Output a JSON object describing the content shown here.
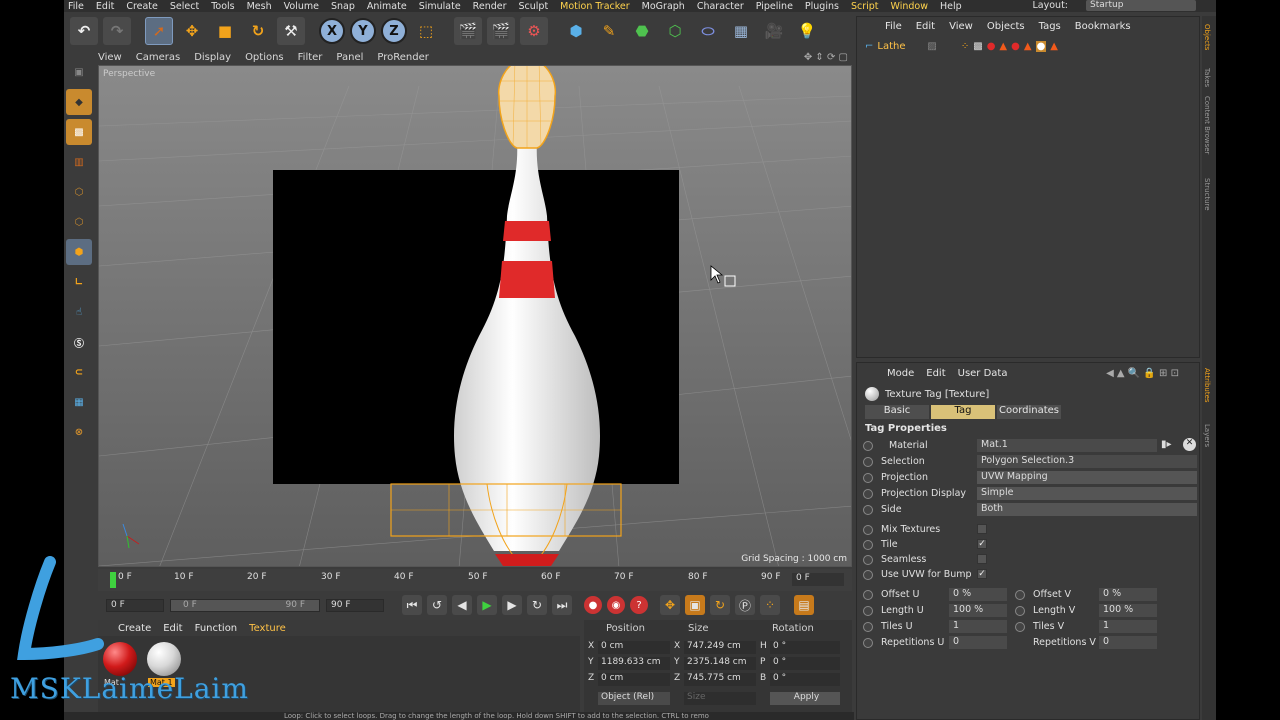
{
  "menubar": {
    "items": [
      "File",
      "Edit",
      "Create",
      "Select",
      "Tools",
      "Mesh",
      "Volume",
      "Snap",
      "Animate",
      "Simulate",
      "Render",
      "Sculpt",
      "Motion Tracker",
      "MoGraph",
      "Character",
      "Pipeline",
      "Plugins",
      "Script",
      "Window",
      "Help"
    ],
    "layout_label": "Layout:",
    "layout_value": "Startup"
  },
  "viewport": {
    "menu": [
      "View",
      "Cameras",
      "Display",
      "Options",
      "Filter",
      "Panel",
      "ProRender"
    ],
    "label": "Perspective",
    "grid_spacing": "Grid Spacing : 1000 cm"
  },
  "timeline": {
    "ticks": [
      "0 F",
      "10 F",
      "20 F",
      "30 F",
      "40 F",
      "50 F",
      "60 F",
      "70 F",
      "80 F",
      "90 F"
    ],
    "current_frame": "0 F",
    "start": "0 F",
    "range_start": "0 F",
    "range_end": "90 F",
    "end": "90 F"
  },
  "material_manager": {
    "menu": [
      "Create",
      "Edit",
      "Function",
      "Texture"
    ],
    "materials": [
      {
        "name": "Mat",
        "color": "#d11a1a"
      },
      {
        "name": "Mat.1",
        "color": "#e8e8e8"
      }
    ]
  },
  "coordinates": {
    "headers": [
      "Position",
      "Size",
      "Rotation"
    ],
    "rows": [
      {
        "axis": "X",
        "pos": "0 cm",
        "size_axis": "X",
        "size": "747.249 cm",
        "rot_axis": "H",
        "rot": "0 °"
      },
      {
        "axis": "Y",
        "pos": "1189.633 cm",
        "size_axis": "Y",
        "size": "2375.148 cm",
        "rot_axis": "P",
        "rot": "0 °"
      },
      {
        "axis": "Z",
        "pos": "0 cm",
        "size_axis": "Z",
        "size": "745.775 cm",
        "rot_axis": "B",
        "rot": "0 °"
      }
    ],
    "mode": "Object (Rel)",
    "size_mode": "Size",
    "apply": "Apply"
  },
  "status": "Loop: Click to select loops. Drag to change the length of the loop. Hold down SHIFT to add to the selection. CTRL to remo",
  "object_manager": {
    "menu": [
      "File",
      "Edit",
      "View",
      "Objects",
      "Tags",
      "Bookmarks"
    ],
    "object_name": "Lathe"
  },
  "attributes": {
    "menu": [
      "Mode",
      "Edit",
      "User Data"
    ],
    "title": "Texture Tag [Texture]",
    "tabs": [
      "Basic",
      "Tag",
      "Coordinates"
    ],
    "active_tab": "Tag",
    "section": "Tag Properties",
    "material_label": "Material",
    "material_value": "Mat.1",
    "selection_label": "Selection",
    "selection_value": "Polygon Selection.3",
    "projection_label": "Projection",
    "projection_value": "UVW Mapping",
    "projection_display_label": "Projection Display",
    "projection_display_value": "Simple",
    "side_label": "Side",
    "side_value": "Both",
    "mix_label": "Mix Textures",
    "tile_label": "Tile",
    "seamless_label": "Seamless",
    "uvw_bump_label": "Use UVW for Bump",
    "offset_u_label": "Offset U",
    "offset_u": "0 %",
    "offset_v_label": "Offset V",
    "offset_v": "0 %",
    "length_u_label": "Length U",
    "length_u": "100 %",
    "length_v_label": "Length V",
    "length_v": "100 %",
    "tiles_u_label": "Tiles U",
    "tiles_u": "1",
    "tiles_v_label": "Tiles V",
    "tiles_v": "1",
    "rep_u_label": "Repetitions U",
    "rep_u": "0",
    "rep_v_label": "Repetitions V",
    "rep_v": "0"
  },
  "side_tabs": [
    "Objects",
    "Takes",
    "Content Browser",
    "Structure",
    "Attributes",
    "Layers"
  ],
  "watermark": "MSKLaimeLaim"
}
